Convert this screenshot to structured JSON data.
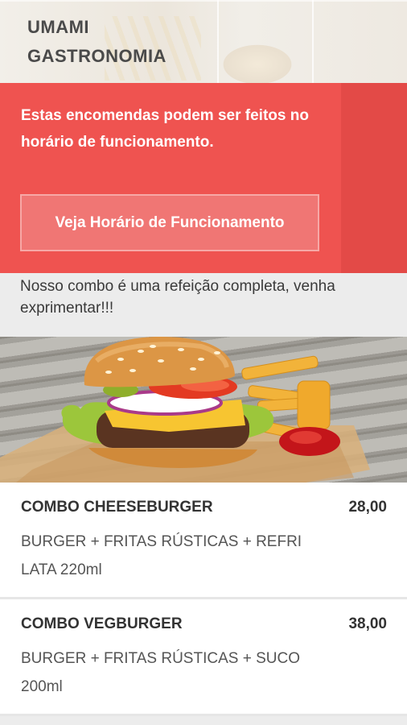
{
  "header": {
    "brand_line1": "UMAMI",
    "brand_line2": "GASTRONOMIA"
  },
  "notice": {
    "text": "Estas encomendas podem ser feitos no horário de funcionamento.",
    "button_label": "Veja Horário de Funcionamento",
    "bg_color": "#ef5350"
  },
  "description": "Nosso combo é uma refeição completa, venha exprimentar!!!",
  "products": [
    {
      "name": "COMBO CHEESEBURGER",
      "price": "28,00",
      "details": "BURGER + FRITAS RÚSTICAS + REFRI LATA 220ml"
    },
    {
      "name": "COMBO VEGBURGER",
      "price": "38,00",
      "details": "BURGER + FRITAS RÚSTICAS + SUCO 200ml"
    }
  ]
}
